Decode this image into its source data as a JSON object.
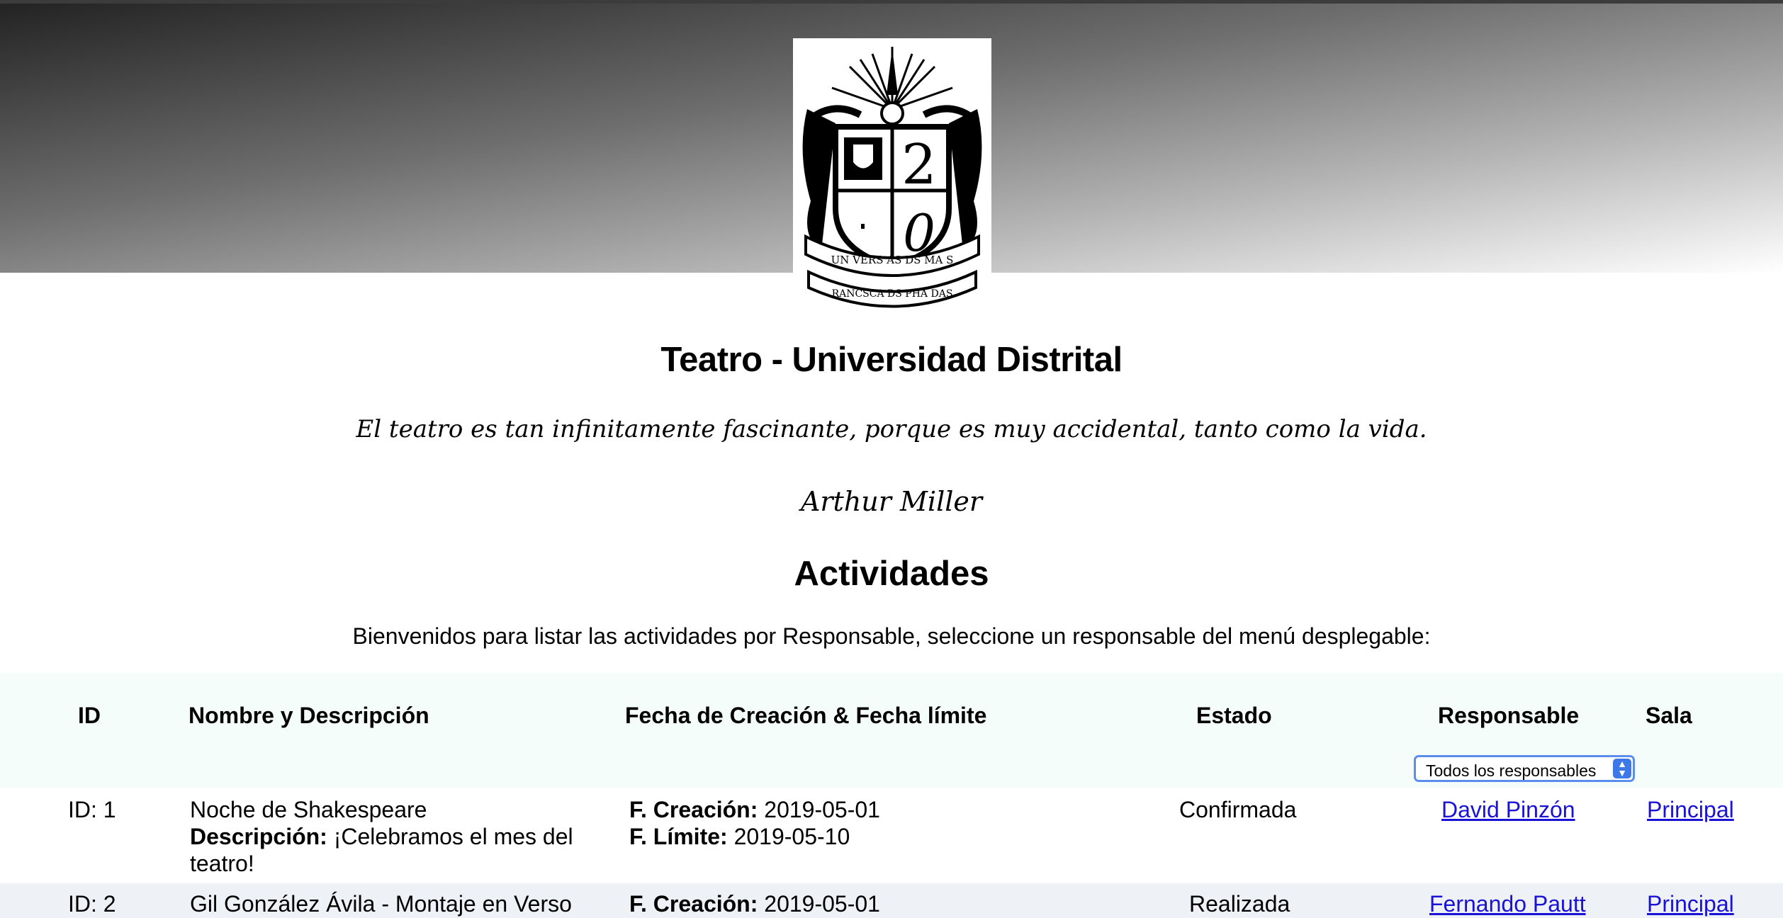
{
  "header": {
    "title": "Teatro - Universidad Distrital",
    "quote": "El teatro es tan infinitamente fascinante, porque es muy accidental, tanto como la vida.",
    "author": "Arthur Miller",
    "logo_text_top": "UN VERS AS DS MA S",
    "logo_text_bottom": "RANCSCA DS PHA DAS"
  },
  "section": {
    "title": "Actividades",
    "intro": "Bienvenidos para listar las actividades por Responsable, seleccione un responsable del menú desplegable:"
  },
  "table": {
    "headers": {
      "id": "ID",
      "name": "Nombre y Descripción",
      "dates": "Fecha de Creación & Fecha límite",
      "status": "Estado",
      "responsible": "Responsable",
      "room": "Sala"
    },
    "filter": {
      "selected": "Todos los responsables"
    },
    "labels": {
      "description": "Descripción:",
      "created": "F. Creación:",
      "deadline": "F. Límite:"
    },
    "rows": [
      {
        "id": "ID: 1",
        "name": "Noche de Shakespeare",
        "description": "¡Celebramos el mes del teatro!",
        "created": "2019-05-01",
        "deadline": "2019-05-10",
        "status": "Confirmada",
        "responsible": "David Pinzón",
        "room": "Principal"
      },
      {
        "id": "ID: 2",
        "name": "Gil González Ávila - Montaje en Verso",
        "created": "2019-05-01",
        "status": "Realizada",
        "responsible": "Fernando Pautt",
        "room": "Principal"
      }
    ]
  },
  "colors": {
    "link": "#1a13d6",
    "header_band": "#f4fdfa",
    "alt_row": "#eef1f6",
    "select_border": "#5b8def"
  }
}
